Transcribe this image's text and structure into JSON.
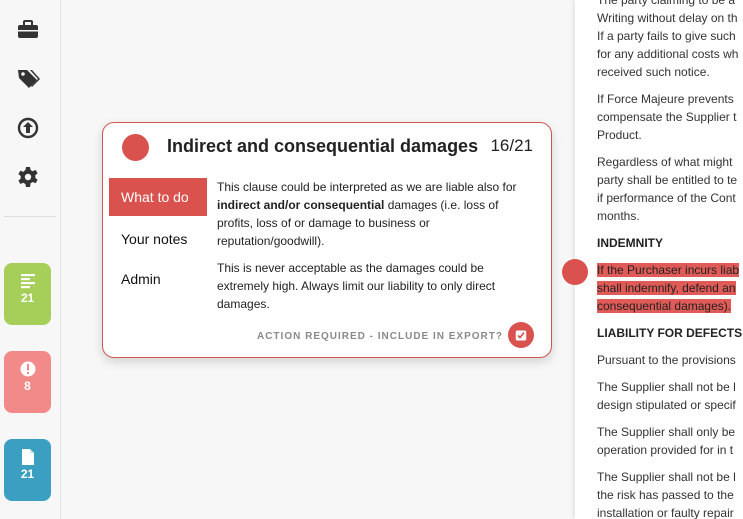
{
  "sidebar": {
    "icons": [
      "briefcase-icon",
      "tags-icon",
      "upload-icon",
      "gear-icon"
    ],
    "counts": [
      {
        "icon": "align-left-icon",
        "value": "21",
        "color": "#a5cf59"
      },
      {
        "icon": "exclamation-icon",
        "value": "8",
        "color": "#f28a8a"
      },
      {
        "icon": "document-icon",
        "value": "21",
        "color": "#3b9fc2"
      }
    ]
  },
  "card": {
    "title": "Indirect and consequential damages",
    "counter": "16/21",
    "tabs": [
      "What to do",
      "Your notes",
      "Admin"
    ],
    "para1_pre": "This clause could be interpreted as we are liable also for ",
    "para1_bold": "indirect and/or consequential",
    "para1_post": " damages (i.e. loss of profits, loss of or damage to business or reputation/goodwill).",
    "para2": "This is never acceptable as the damages could be extremely high. Always limit our liability to only direct damages.",
    "footer": "ACTION REQUIRED - INCLUDE IN EXPORT?",
    "accent": "#d9524d"
  },
  "document": {
    "lines": [
      [
        "The party claiming to be a",
        "Writing without delay on th",
        "If a party fails to give such",
        "for any additional costs wh",
        "received such notice."
      ],
      [
        "If Force Majeure prevents",
        "compensate the Supplier t",
        "Product."
      ],
      [
        "Regardless of what might",
        "party shall be entitled to te",
        "if performance of the Cont",
        "months."
      ]
    ],
    "heading_indemnity": "INDEMNITY",
    "highlight": [
      "If the Purchaser incurs liab",
      "shall indemnify, defend an",
      "consequential damages)."
    ],
    "heading_liability": "LIABILITY FOR DEFECTS",
    "lines2": [
      [
        "Pursuant to the provisions"
      ],
      [
        "The Supplier shall not be l",
        "design stipulated or specif"
      ],
      [
        "The Supplier shall only be",
        "operation provided for in t"
      ],
      [
        "The Supplier shall not be l",
        "the risk has passed to the",
        "installation or faulty repair"
      ]
    ]
  }
}
